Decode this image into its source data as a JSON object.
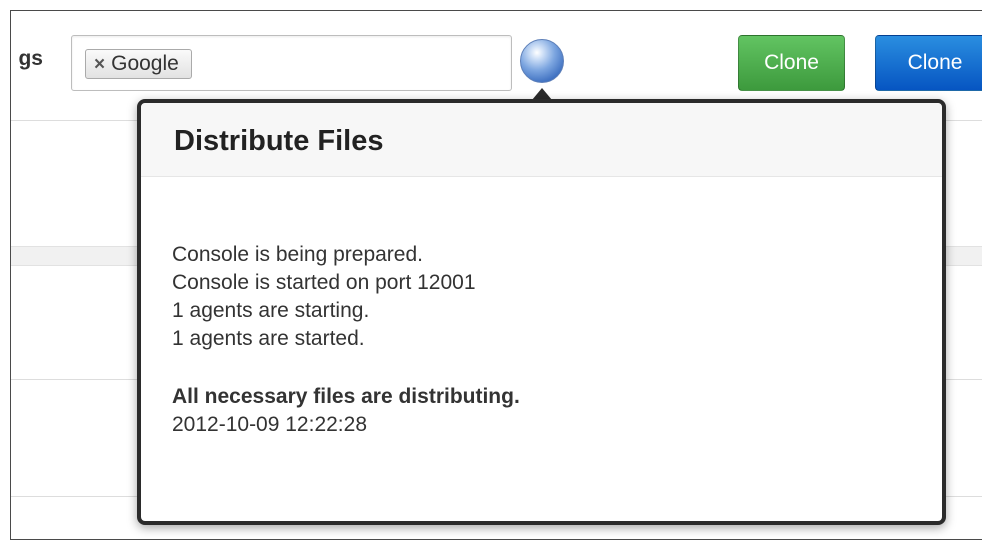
{
  "toolbar": {
    "label": "gs",
    "tags": [
      {
        "remove_icon": "×",
        "label": "Google"
      }
    ],
    "clone_green_label": "Clone",
    "clone_blue_label": "Clone"
  },
  "popover": {
    "title": "Distribute Files",
    "log_lines": [
      "Console is being prepared.",
      "Console is started on port 12001",
      "1 agents are starting.",
      "1 agents are started."
    ],
    "status": "All necessary files are distributing.",
    "timestamp": "2012-10-09 12:22:28"
  },
  "colors": {
    "green_button": "#4cae4c",
    "blue_button": "#0a6cd6",
    "popover_border": "#2b2b2b"
  },
  "icons": {
    "status_globe": "globe-icon",
    "tag_remove": "close-icon"
  }
}
